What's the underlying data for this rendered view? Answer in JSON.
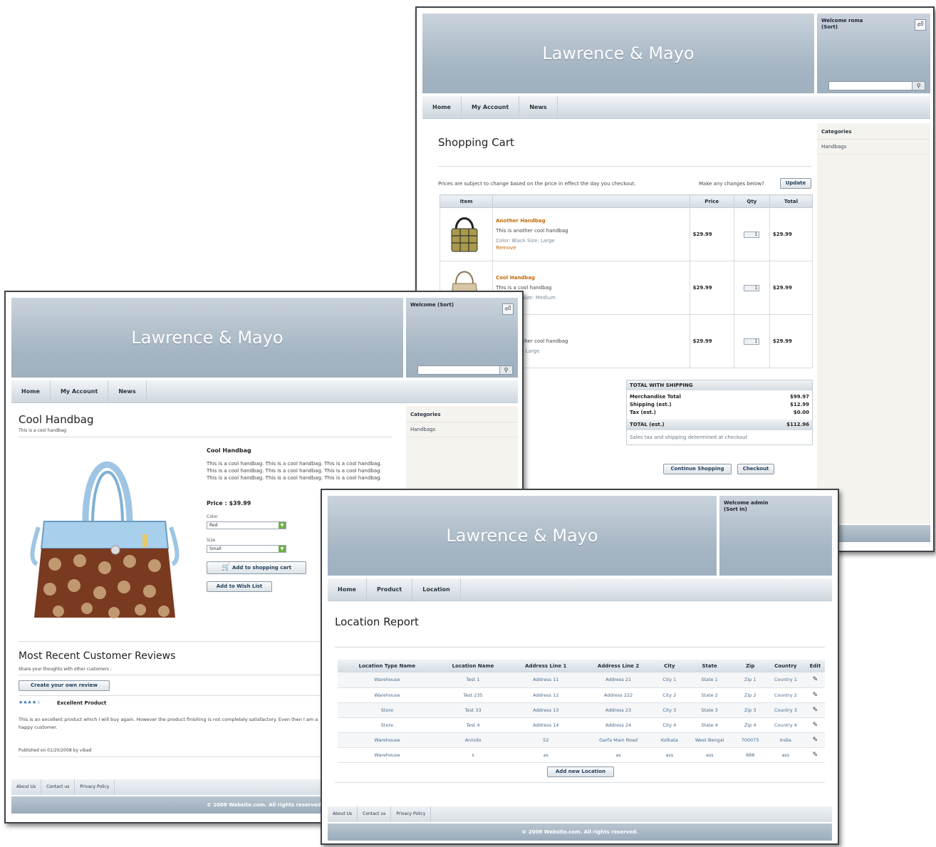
{
  "cart_window": {
    "brand": "Lawrence & Mayo",
    "welcome": "Welcome roma (Sort)",
    "nav": [
      "Home",
      "My Account",
      "News"
    ],
    "title": "Shopping Cart",
    "price_note": "Prices are subject to change based on the price in effect the day you checkout.",
    "changes_note": "Make any changes below?",
    "update_label": "Update",
    "headers": {
      "item": "Item",
      "price": "Price",
      "qty": "Qty",
      "total": "Total"
    },
    "items": [
      {
        "name": "Another Handbag",
        "desc": "This is another cool handbag",
        "options": "Color: Black Size: Large",
        "remove": "Remove",
        "price": "$29.99",
        "qty": "1",
        "total": "$29.99"
      },
      {
        "name": "Cool Handbag",
        "desc": "This is a cool handbag",
        "options": "Color: Tan Size: Medium",
        "remove": "",
        "price": "$29.99",
        "qty": "1",
        "total": "$29.99"
      },
      {
        "name": "Handbag",
        "desc": "This is another cool handbag",
        "options": "Color: Size: Large",
        "remove": "",
        "price": "$29.99",
        "qty": "1",
        "total": "$29.99"
      }
    ],
    "totals": {
      "header": "TOTAL WITH SHIPPING",
      "merch_label": "Merchandise Total",
      "merch_value": "$99.97",
      "ship_label": "Shipping (est.)",
      "ship_value": "$12.99",
      "tax_label": "Tax (est.)",
      "tax_value": "$0.00",
      "total_label": "TOTAL (est.)",
      "total_value": "$112.96",
      "note": "Sales tax and shipping determined at checkout"
    },
    "continue_label": "Continue Shopping",
    "checkout_label": "Checkout",
    "sidebar_title": "Categories",
    "sidebar_items": [
      "Handbags"
    ]
  },
  "product_window": {
    "brand": "Lawrence & Mayo",
    "welcome": "Welcome (Sort)",
    "nav": [
      "Home",
      "My Account",
      "News"
    ],
    "title": "Cool Handbag",
    "subtitle": "This is a cool handbag",
    "product_name": "Cool Handbag",
    "description": "This is a cool handbag. This is a cool handbag. This is a cool handbag. This is a cool handbag. This is a cool handbag. This is a cool handbag. This is a cool handbag. This is a cool handbag. This is a cool handbag.",
    "price": "Price : $39.99",
    "color_label": "Color",
    "color_value": "Red",
    "size_label": "Size",
    "size_value": "Small",
    "add_cart_label": "Add to shopping cart",
    "add_wish_label": "Add to Wish List",
    "reviews_title": "Most Recent Customer Reviews",
    "reviews_sub": "Share your thoughts with other customers :",
    "create_review_label": "Create your own review",
    "stars": "★★★★☆",
    "review_title": "Excellent Product",
    "review_text": "This is an excellent product which I will buy again. However the product finishing is not completely satisfactory. Even then I am a happy customer.",
    "published": "Published on 01/20/2008 by vibad",
    "footer_links": [
      "About Us",
      "Contact us",
      "Privacy Policy"
    ],
    "copyright": "© 2008 Website.com. All rights reserved.",
    "sidebar_title": "Categories",
    "sidebar_items": [
      "Handbags"
    ]
  },
  "report_window": {
    "brand": "Lawrence & Mayo",
    "welcome": "Welcome admin (Sort in)",
    "nav": [
      "Home",
      "Product",
      "Location"
    ],
    "title": "Location Report",
    "headers": [
      "Location Type Name",
      "Location Name",
      "Address Line 1",
      "Address Line 2",
      "City",
      "State",
      "Zip",
      "Country",
      "Edit"
    ],
    "rows": [
      [
        "Warehouse",
        "Test 1",
        "Address 11",
        "Address 21",
        "City 1",
        "State 1",
        "Zip 1",
        "Country 1"
      ],
      [
        "Warehouse",
        "Test 235",
        "Address 12",
        "Address 222",
        "City 2",
        "State 2",
        "Zip 2",
        "Country 2"
      ],
      [
        "Store",
        "Test 33",
        "Address 13",
        "Address 23",
        "City 3",
        "State 3",
        "Zip 3",
        "Country 3"
      ],
      [
        "Store",
        "Test 4",
        "Address 14",
        "Address 24",
        "City 4",
        "State 4",
        "Zip 4",
        "Country 4"
      ],
      [
        "Warehouse",
        "Anindo",
        "52",
        "Garfa Main Road",
        "Kolkata",
        "West Bengal",
        "700075",
        "India"
      ],
      [
        "Warehouse",
        "s",
        "as",
        "as",
        "ass",
        "ass",
        "888",
        "ass"
      ]
    ],
    "add_label": "Add new Location",
    "footer_links": [
      "About Us",
      "Contact us",
      "Privacy Policy"
    ],
    "copyright": "© 2008 Website.com. All rights reserved."
  }
}
